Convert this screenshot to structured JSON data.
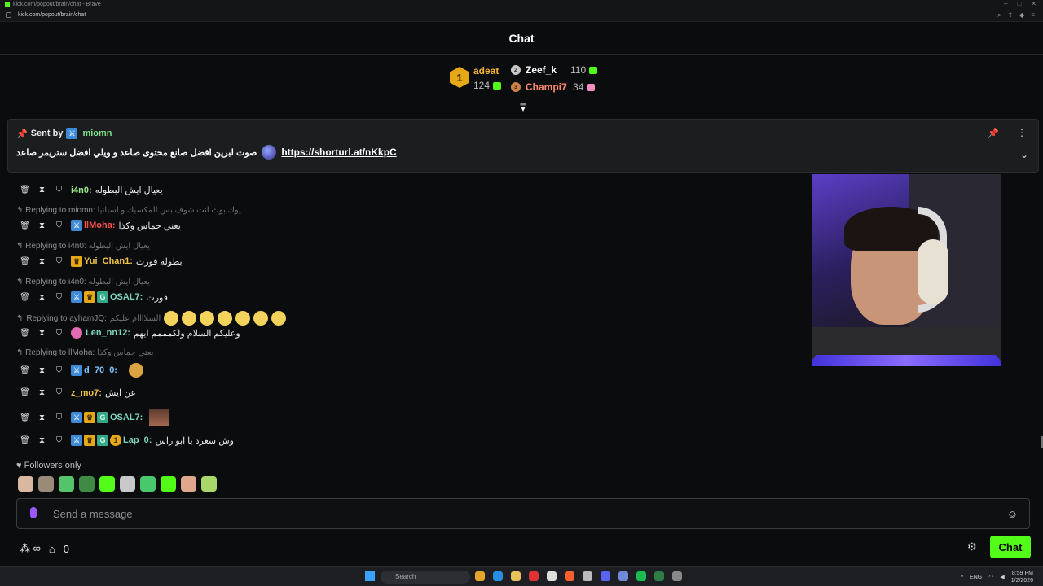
{
  "browser": {
    "title": "kick.com/popout/brain/chat - Brave",
    "url": "kick.com/popout/brain/chat"
  },
  "header": {
    "title": "Chat"
  },
  "leaderboard": {
    "first": {
      "rank": "1",
      "name": "adeat",
      "value": "124"
    },
    "second": {
      "rank": "2",
      "name": "Zeef_k",
      "value": "110"
    },
    "third": {
      "rank": "3",
      "name": "Champi7",
      "value": "34"
    }
  },
  "pinned": {
    "sent_by_label": "Sent by",
    "sender": "miomn",
    "message": "صوت لبرين افضل صانع محتوى صاعد و ويلي افضل ستريمر صاعد",
    "link": "https://shorturl.at/nKkpC"
  },
  "messages": [
    {
      "user": "i4n0:",
      "color": "#9ee68a",
      "text": "يعيال ايش البطوله"
    },
    {
      "reply_to": "Replying to miomn:",
      "reply_text": "يوك بوث انت شوف بس المكسيك و اسبانيا",
      "user": "llMoha:",
      "color": "#ff4f4f",
      "text": "يعني حماس وكذا"
    },
    {
      "reply_to": "Replying to i4n0:",
      "reply_text": "يعيال ايش البطوله",
      "user": "Yui_Chan1:",
      "color": "#f2c34a",
      "text": "بطوله فورت"
    },
    {
      "reply_to": "Replying to i4n0:",
      "reply_text": "يعيال ايش البطوله",
      "user": "OSAL7:",
      "color": "#7fd6c2",
      "text": "فورت"
    },
    {
      "reply_to": "Replying to ayhamJQ:",
      "reply_text": "السلاااام عليكم",
      "user": "Len_nn12:",
      "color": "#7fd6c2",
      "text": "وعليكم السلام ولكمممم ايهم"
    },
    {
      "reply_to": "Replying to llMoha:",
      "reply_text": "يعني حماس وكذا",
      "user": "d_70_0:",
      "color": "#7fc4ff",
      "text": ""
    },
    {
      "user": "z_mo7:",
      "color": "#f2c34a",
      "text": "عن ايش"
    },
    {
      "user": "OSAL7:",
      "color": "#7fd6c2",
      "text": ""
    },
    {
      "user": "Lap_0:",
      "color": "#7fd6c2",
      "text": "وش سغرد يا ابو راس"
    }
  ],
  "followers_label": "Followers only",
  "input": {
    "placeholder": "Send a message"
  },
  "bottom": {
    "points": "0",
    "chat_button": "Chat"
  },
  "taskbar": {
    "search": "Search",
    "lang": "ENG",
    "time": "8:59 PM",
    "date": "1/2/2026"
  },
  "colors": {
    "accent": "#53fc18",
    "gold": "#f2b233"
  }
}
